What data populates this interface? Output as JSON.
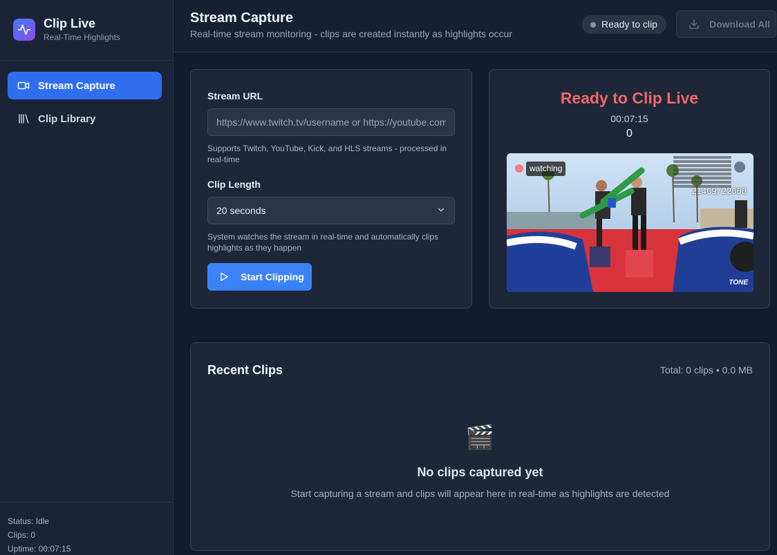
{
  "brand": {
    "title": "Clip Live",
    "subtitle": "Real-Time Highlights"
  },
  "sidebar": {
    "items": [
      {
        "label": "Stream Capture",
        "icon": "video-camera-icon",
        "active": true
      },
      {
        "label": "Clip Library",
        "icon": "library-icon",
        "active": false
      }
    ],
    "stats": {
      "status": "Status: Idle",
      "clips": "Clips: 0",
      "uptime": "Uptime: 00:07:15"
    }
  },
  "header": {
    "title": "Stream Capture",
    "subtitle": "Real-time stream monitoring - clips are created instantly as highlights occur",
    "status_pill": "Ready to clip",
    "download_label": "Download All"
  },
  "form": {
    "url_label": "Stream URL",
    "url_placeholder": "https://www.twitch.tv/username or https://youtube.com/...",
    "url_help": "Supports Twitch, YouTube, Kick, and HLS streams - processed in real-time",
    "length_label": "Clip Length",
    "length_value": "20 seconds",
    "length_help": "System watches the stream in real-time and automatically clips highlights as they happen",
    "start_label": "Start Clipping"
  },
  "preview": {
    "title": "Ready to Clip Live",
    "time": "00:07:15",
    "count": "0",
    "badge": "watching",
    "score": "21409/22000",
    "watermark": "TONE"
  },
  "clips": {
    "title": "Recent Clips",
    "meta": "Total: 0 clips  •  0.0 MB",
    "empty_icon": "🎬",
    "empty_title": "No clips captured yet",
    "empty_sub": "Start capturing a stream and clips will appear here in real-time as highlights are detected"
  },
  "colors": {
    "accent": "#2f6fef",
    "button": "#3b82f6",
    "title_red": "#f06767",
    "background": "#131c2e"
  }
}
